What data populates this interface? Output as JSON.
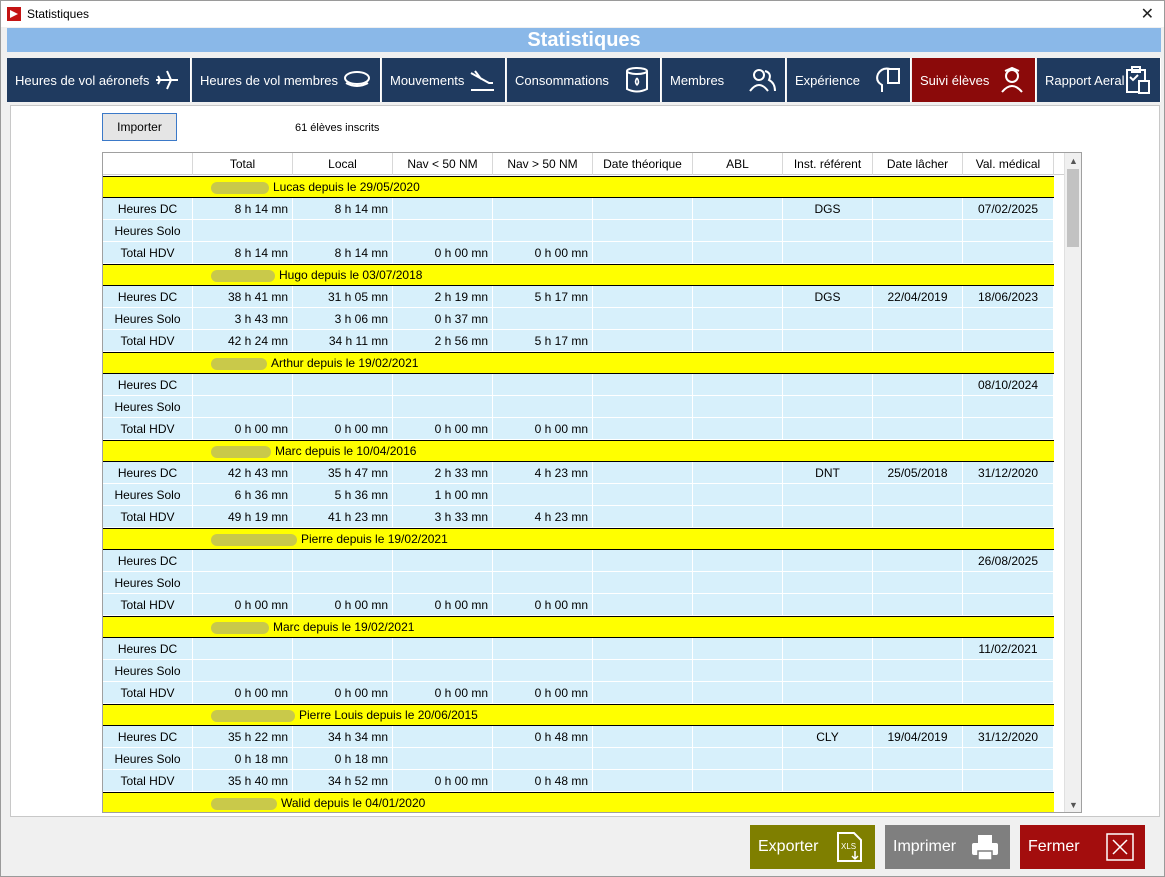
{
  "window": {
    "title": "Statistiques",
    "close_glyph": "✕"
  },
  "header": {
    "title": "Statistiques"
  },
  "tabs": [
    {
      "label": "Heures de vol aéronefs",
      "icon": "airplane-icon"
    },
    {
      "label": "Heures de vol membres",
      "icon": "pilot-cap-icon"
    },
    {
      "label": "Mouvements",
      "icon": "landing-icon"
    },
    {
      "label": "Consommations",
      "icon": "fuel-barrel-icon"
    },
    {
      "label": "Membres",
      "icon": "members-icon"
    },
    {
      "label": "Expérience",
      "icon": "experience-icon"
    },
    {
      "label": "Suivi élèves",
      "icon": "student-icon",
      "active": true
    },
    {
      "label": "Rapport Aeral",
      "icon": "report-icon"
    }
  ],
  "toolbar": {
    "import_label": "Importer",
    "enrolled_text": "61 élèves inscrits"
  },
  "grid": {
    "columns": [
      "",
      "Total",
      "Local",
      "Nav < 50 NM",
      "Nav > 50 NM",
      "Date théorique",
      "ABL",
      "Inst. référent",
      "Date lâcher",
      "Val. médical"
    ],
    "students": [
      {
        "header": "Lucas  depuis le 29/05/2020",
        "rows": [
          [
            "Heures DC",
            "8 h 14 mn",
            "8 h 14 mn",
            "",
            "",
            "",
            "",
            "DGS",
            "",
            "07/02/2025"
          ],
          [
            "Heures Solo",
            "",
            "",
            "",
            "",
            "",
            "",
            "",
            "",
            ""
          ],
          [
            "Total HDV",
            "8 h 14 mn",
            "8 h 14 mn",
            "0 h 00 mn",
            "0 h 00 mn",
            "",
            "",
            "",
            "",
            ""
          ]
        ]
      },
      {
        "header": "Hugo  depuis le 03/07/2018",
        "rows": [
          [
            "Heures DC",
            "38 h 41 mn",
            "31 h 05 mn",
            "2 h 19 mn",
            "5 h 17 mn",
            "",
            "",
            "DGS",
            "22/04/2019",
            "18/06/2023"
          ],
          [
            "Heures Solo",
            "3 h 43 mn",
            "3 h 06 mn",
            "0 h 37 mn",
            "",
            "",
            "",
            "",
            "",
            ""
          ],
          [
            "Total HDV",
            "42 h 24 mn",
            "34 h 11 mn",
            "2 h 56 mn",
            "5 h 17 mn",
            "",
            "",
            "",
            "",
            ""
          ]
        ]
      },
      {
        "header": "Arthur  depuis le 19/02/2021",
        "rows": [
          [
            "Heures DC",
            "",
            "",
            "",
            "",
            "",
            "",
            "",
            "",
            "08/10/2024"
          ],
          [
            "Heures Solo",
            "",
            "",
            "",
            "",
            "",
            "",
            "",
            "",
            ""
          ],
          [
            "Total HDV",
            "0 h 00 mn",
            "0 h 00 mn",
            "0 h 00 mn",
            "0 h 00 mn",
            "",
            "",
            "",
            "",
            ""
          ]
        ]
      },
      {
        "header": "Marc  depuis le 10/04/2016",
        "rows": [
          [
            "Heures DC",
            "42 h 43 mn",
            "35 h 47 mn",
            "2 h 33 mn",
            "4 h 23 mn",
            "",
            "",
            "DNT",
            "25/05/2018",
            "31/12/2020"
          ],
          [
            "Heures Solo",
            "6 h 36 mn",
            "5 h 36 mn",
            "1 h 00 mn",
            "",
            "",
            "",
            "",
            "",
            ""
          ],
          [
            "Total HDV",
            "49 h 19 mn",
            "41 h 23 mn",
            "3 h 33 mn",
            "4 h 23 mn",
            "",
            "",
            "",
            "",
            ""
          ]
        ]
      },
      {
        "header": "Pierre  depuis le 19/02/2021",
        "rows": [
          [
            "Heures DC",
            "",
            "",
            "",
            "",
            "",
            "",
            "",
            "",
            "26/08/2025"
          ],
          [
            "Heures Solo",
            "",
            "",
            "",
            "",
            "",
            "",
            "",
            "",
            ""
          ],
          [
            "Total HDV",
            "0 h 00 mn",
            "0 h 00 mn",
            "0 h 00 mn",
            "0 h 00 mn",
            "",
            "",
            "",
            "",
            ""
          ]
        ]
      },
      {
        "header": "Marc  depuis le 19/02/2021",
        "rows": [
          [
            "Heures DC",
            "",
            "",
            "",
            "",
            "",
            "",
            "",
            "",
            "11/02/2021"
          ],
          [
            "Heures Solo",
            "",
            "",
            "",
            "",
            "",
            "",
            "",
            "",
            ""
          ],
          [
            "Total HDV",
            "0 h 00 mn",
            "0 h 00 mn",
            "0 h 00 mn",
            "0 h 00 mn",
            "",
            "",
            "",
            "",
            ""
          ]
        ]
      },
      {
        "header": "Pierre Louis  depuis le 20/06/2015",
        "rows": [
          [
            "Heures DC",
            "35 h 22 mn",
            "34 h 34 mn",
            "",
            "0 h 48 mn",
            "",
            "",
            "CLY",
            "19/04/2019",
            "31/12/2020"
          ],
          [
            "Heures Solo",
            "0 h 18 mn",
            "0 h 18 mn",
            "",
            "",
            "",
            "",
            "",
            "",
            ""
          ],
          [
            "Total HDV",
            "35 h 40 mn",
            "34 h 52 mn",
            "0 h 00 mn",
            "0 h 48 mn",
            "",
            "",
            "",
            "",
            ""
          ]
        ]
      },
      {
        "header": "Walid  depuis le 04/01/2020",
        "rows": []
      }
    ]
  },
  "footer": {
    "export_label": "Exporter",
    "print_label": "Imprimer",
    "close_label": "Fermer",
    "export_color": "#7f7f00",
    "print_color": "#7f7f7f",
    "close_color": "#a30d0d"
  },
  "colors": {
    "title_band": "#8ab8e8",
    "tab_bg": "#1f3a5f",
    "tab_active": "#8b0a0a",
    "student_band": "#ffff00",
    "cell_bg": "#d7f0fb"
  }
}
